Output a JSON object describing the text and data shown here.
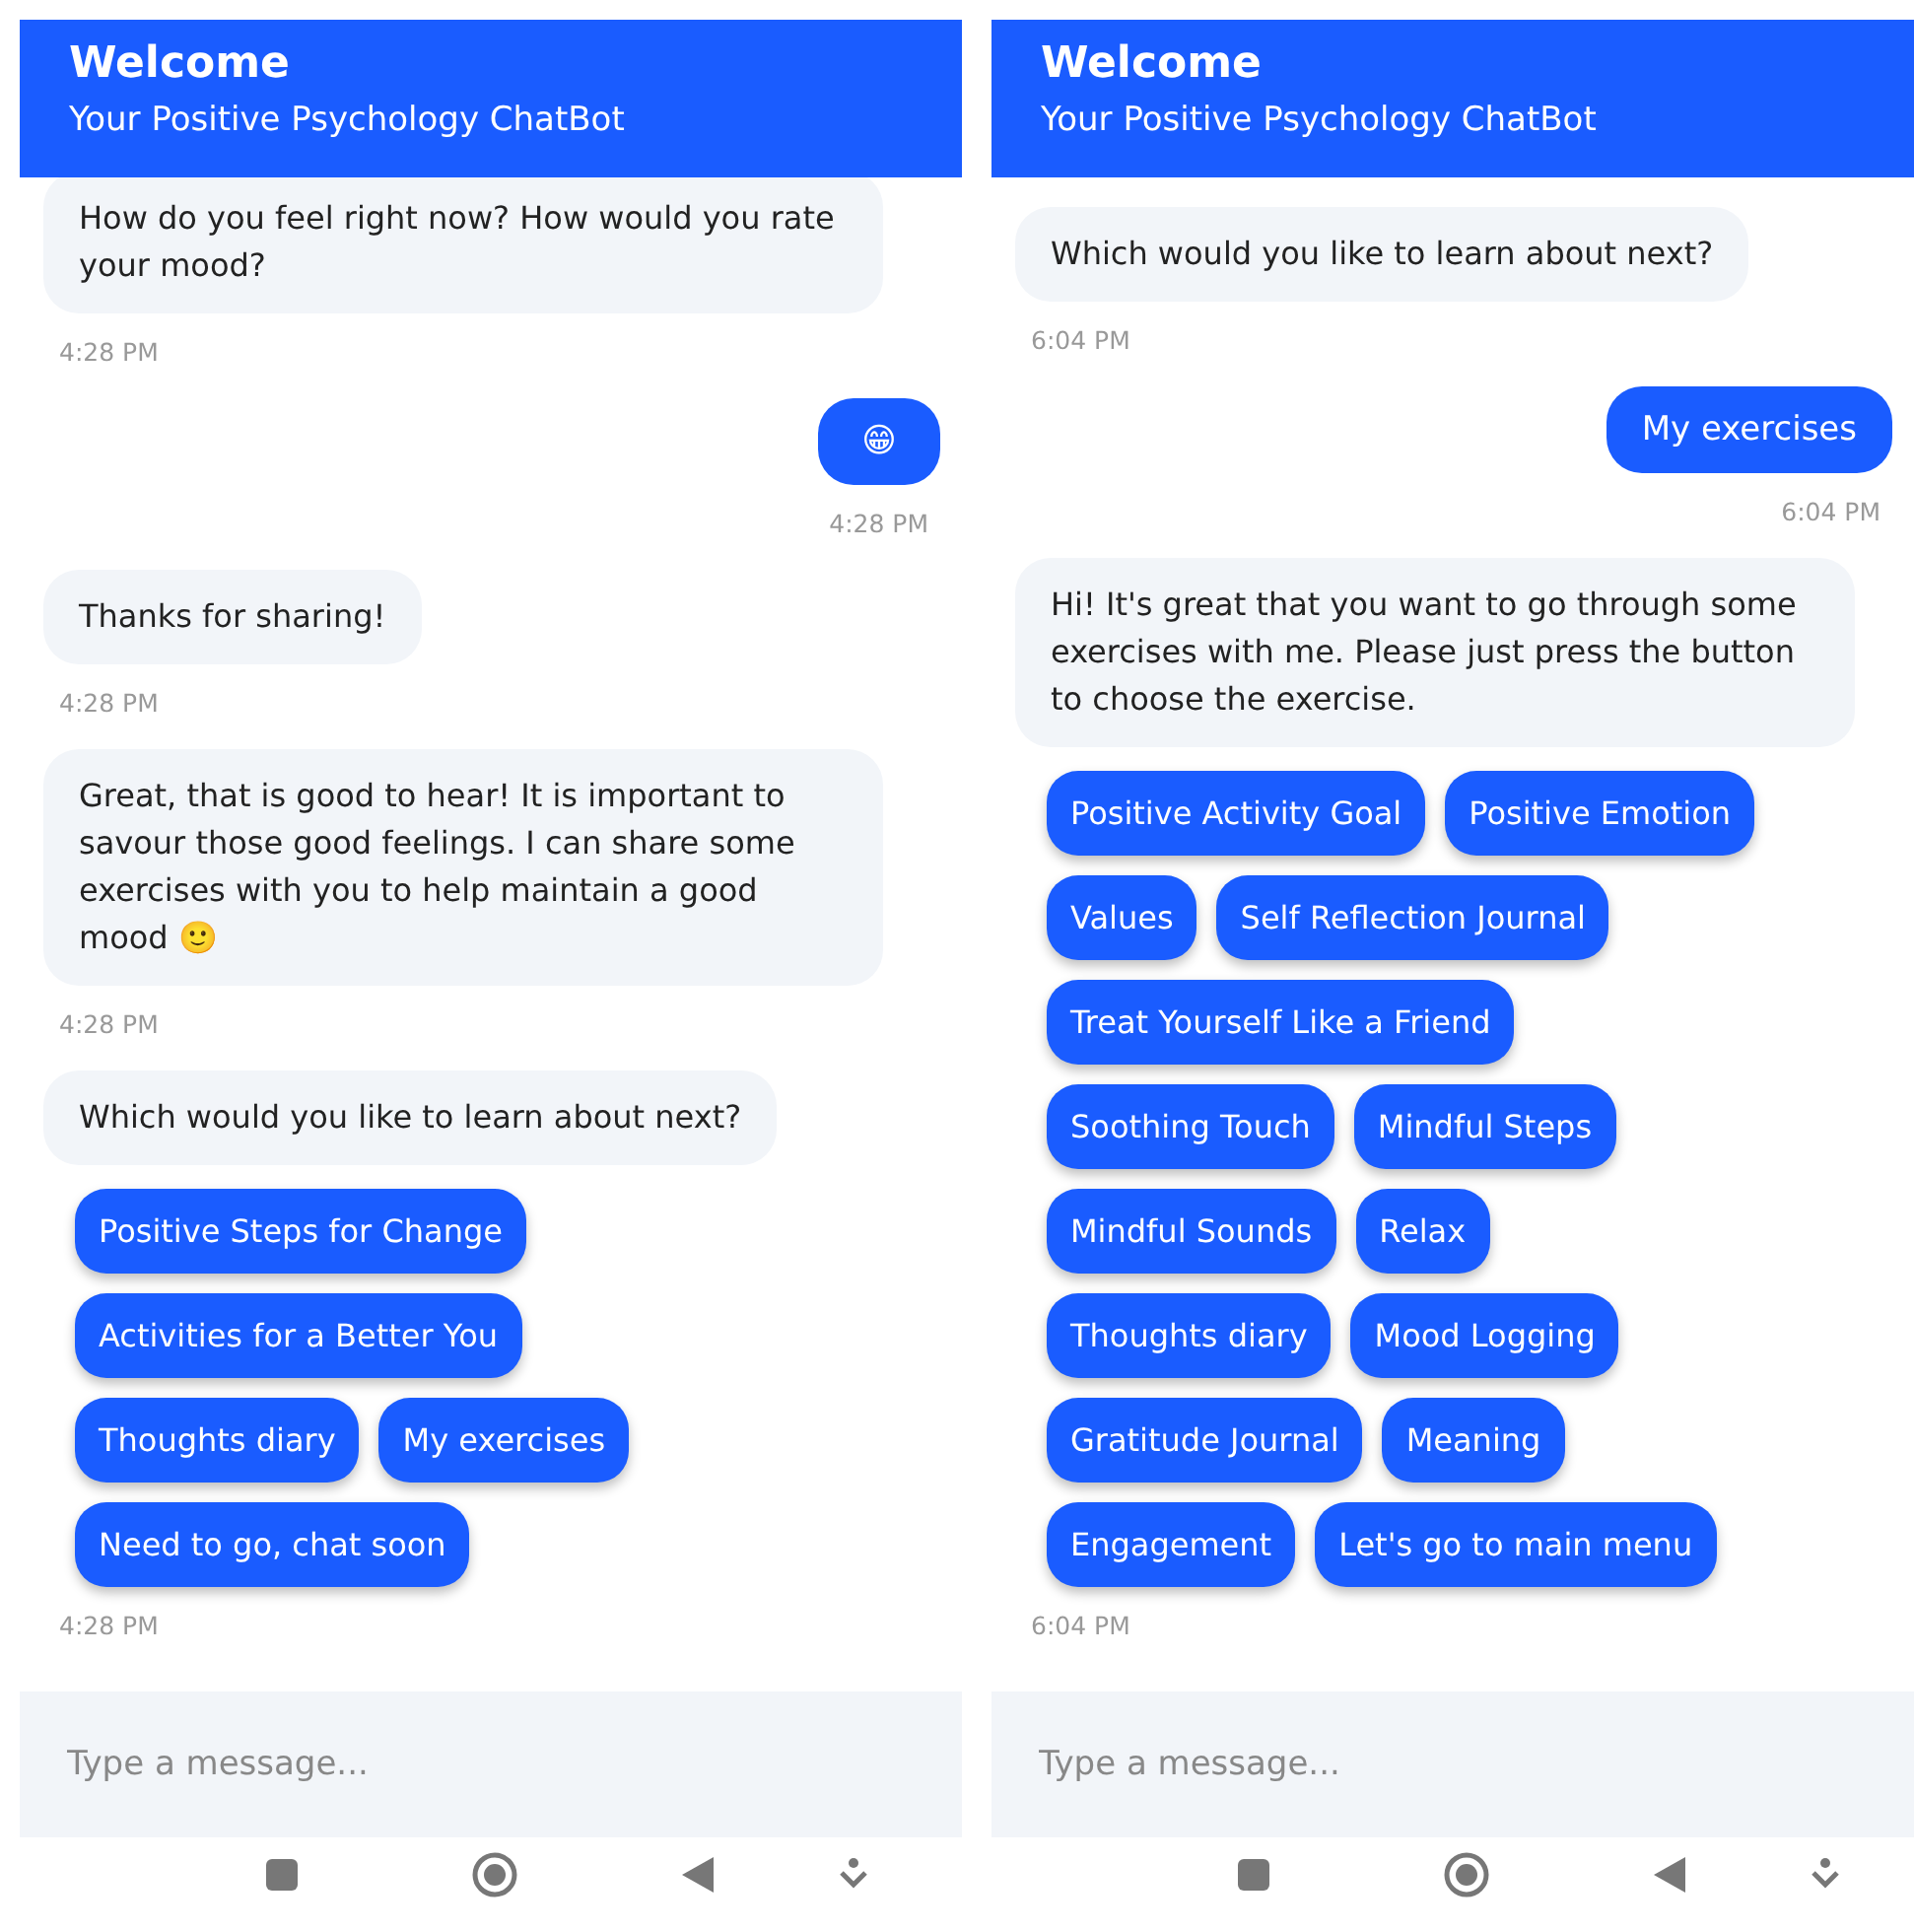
{
  "screens": [
    {
      "header": {
        "title": "Welcome",
        "subtitle": "Your Positive Psychology ChatBot"
      },
      "messages": [
        {
          "kind": "bot",
          "text": "How do you feel right now? How would you rate your mood?",
          "time": "4:28 PM"
        },
        {
          "kind": "user",
          "text": "😁",
          "time": "4:28 PM"
        },
        {
          "kind": "bot",
          "text": "Thanks for sharing!",
          "time": "4:28 PM"
        },
        {
          "kind": "bot",
          "text": "Great, that is good to hear! It is important to savour those good feelings. I can share some exercises with you to help maintain a good mood 🙂",
          "time": "4:28 PM"
        },
        {
          "kind": "bot",
          "text": "Which would you like to learn about next?"
        },
        {
          "kind": "options",
          "rows": [
            [
              "Positive Steps for Change"
            ],
            [
              "Activities for a Better You"
            ],
            [
              "Thoughts diary",
              "My exercises"
            ],
            [
              "Need to go, chat soon"
            ]
          ],
          "time": "4:28 PM"
        }
      ],
      "input": {
        "placeholder": "Type a message..."
      }
    },
    {
      "header": {
        "title": "Welcome",
        "subtitle": "Your Positive Psychology ChatBot"
      },
      "messages": [
        {
          "kind": "bot",
          "text": "Which would you like to learn about next?",
          "time": "6:04 PM"
        },
        {
          "kind": "user",
          "text": "My exercises",
          "time": "6:04 PM"
        },
        {
          "kind": "bot",
          "text": "Hi! It's great that you want to go through some exercises with me. Please just press the button to choose the exercise."
        },
        {
          "kind": "options",
          "rows": [
            [
              "Positive Activity Goal",
              "Positive Emotion"
            ],
            [
              "Values",
              "Self Reflection Journal"
            ],
            [
              "Treat Yourself Like a Friend"
            ],
            [
              "Soothing Touch",
              "Mindful Steps"
            ],
            [
              "Mindful Sounds",
              "Relax"
            ],
            [
              "Thoughts diary",
              "Mood Logging"
            ],
            [
              "Gratitude Journal",
              "Meaning"
            ],
            [
              "Engagement",
              "Let's go to main menu"
            ]
          ],
          "time": "6:04 PM"
        }
      ],
      "input": {
        "placeholder": "Type a message..."
      }
    }
  ]
}
